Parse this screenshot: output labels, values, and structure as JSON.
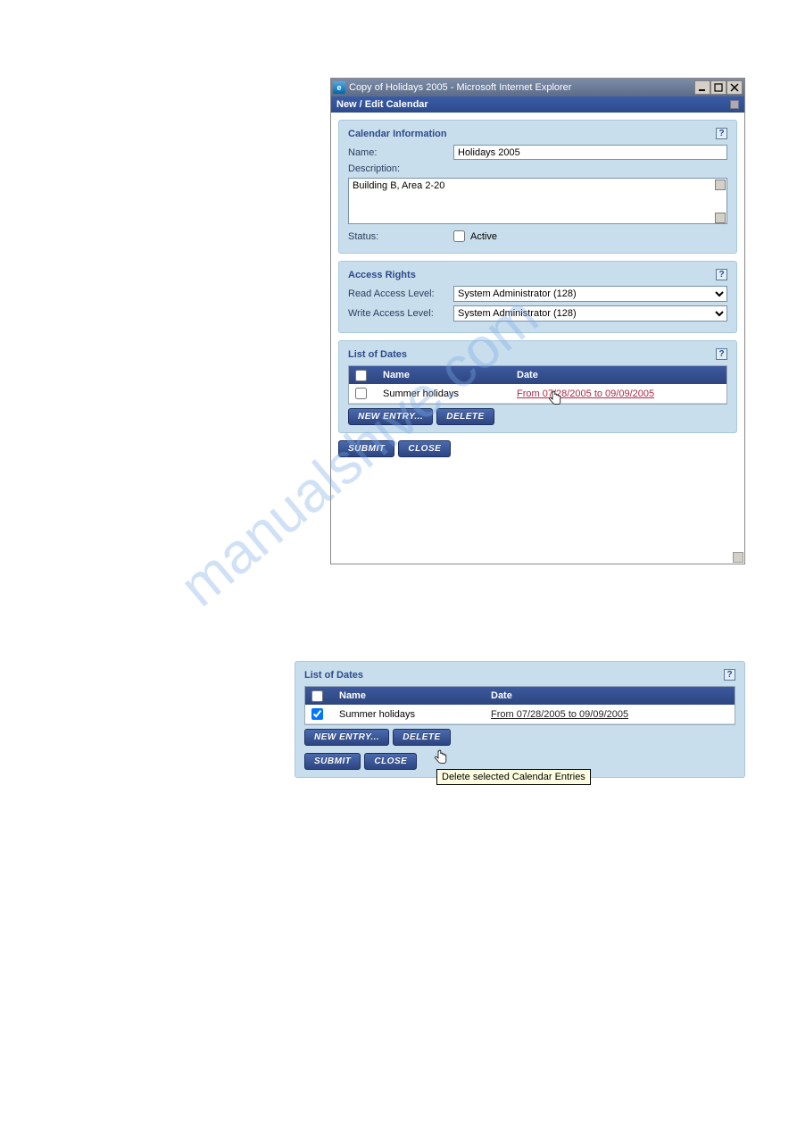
{
  "window": {
    "title": "Copy of Holidays 2005 - Microsoft Internet Explorer",
    "subtitle": "New / Edit Calendar"
  },
  "calendar_info": {
    "heading": "Calendar Information",
    "name_label": "Name:",
    "name_value": "Holidays 2005",
    "description_label": "Description:",
    "description_value": "Building B, Area 2-20",
    "status_label": "Status:",
    "active_label": "Active"
  },
  "access_rights": {
    "heading": "Access Rights",
    "read_label": "Read Access Level:",
    "read_value": "System Administrator (128)",
    "write_label": "Write Access Level:",
    "write_value": "System Administrator (128)"
  },
  "list_of_dates": {
    "heading": "List of Dates",
    "col_name": "Name",
    "col_date": "Date",
    "row_name": "Summer holidays",
    "row_date": "From 07/28/2005 to 09/09/2005",
    "btn_new": "NEW ENTRY...",
    "btn_delete": "DELETE"
  },
  "actions": {
    "submit": "SUBMIT",
    "close": "CLOSE"
  },
  "panel2": {
    "heading": "List of Dates",
    "col_name": "Name",
    "col_date": "Date",
    "row_name": "Summer holidays",
    "row_date": "From 07/28/2005 to 09/09/2005",
    "btn_new": "NEW ENTRY...",
    "btn_delete": "DELETE",
    "tooltip": "Delete selected Calendar Entries",
    "submit": "SUBMIT",
    "close": "CLOSE"
  },
  "watermark": "manualshive.com"
}
